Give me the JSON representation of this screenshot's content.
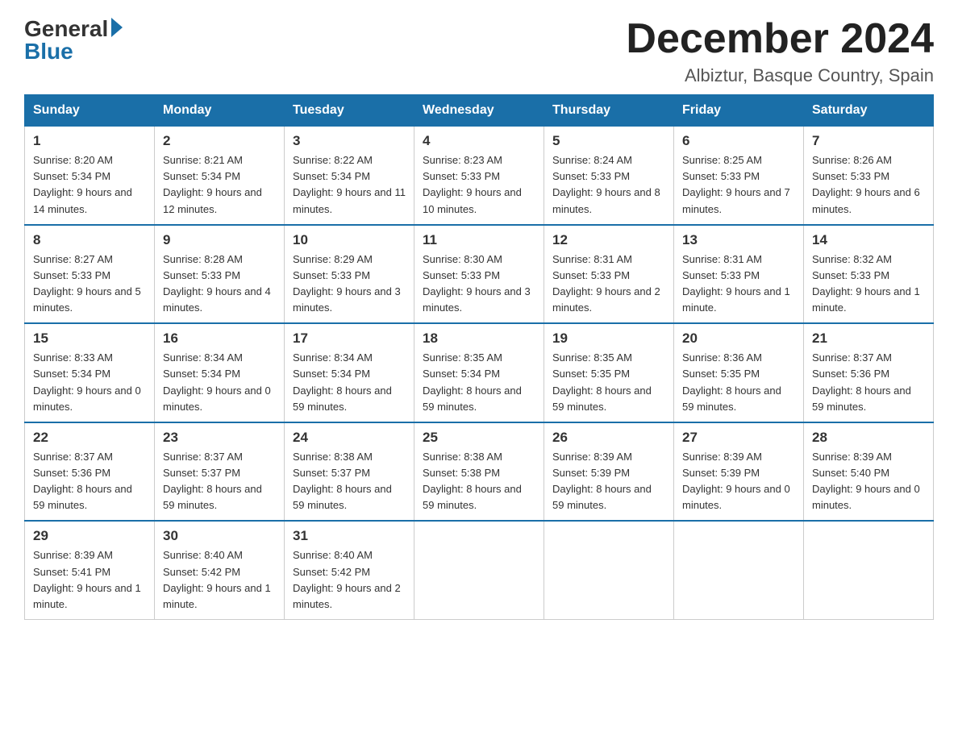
{
  "header": {
    "month_title": "December 2024",
    "location": "Albiztur, Basque Country, Spain",
    "logo_general": "General",
    "logo_blue": "Blue"
  },
  "columns": [
    "Sunday",
    "Monday",
    "Tuesday",
    "Wednesday",
    "Thursday",
    "Friday",
    "Saturday"
  ],
  "weeks": [
    [
      {
        "day": "1",
        "sunrise": "Sunrise: 8:20 AM",
        "sunset": "Sunset: 5:34 PM",
        "daylight": "Daylight: 9 hours and 14 minutes."
      },
      {
        "day": "2",
        "sunrise": "Sunrise: 8:21 AM",
        "sunset": "Sunset: 5:34 PM",
        "daylight": "Daylight: 9 hours and 12 minutes."
      },
      {
        "day": "3",
        "sunrise": "Sunrise: 8:22 AM",
        "sunset": "Sunset: 5:34 PM",
        "daylight": "Daylight: 9 hours and 11 minutes."
      },
      {
        "day": "4",
        "sunrise": "Sunrise: 8:23 AM",
        "sunset": "Sunset: 5:33 PM",
        "daylight": "Daylight: 9 hours and 10 minutes."
      },
      {
        "day": "5",
        "sunrise": "Sunrise: 8:24 AM",
        "sunset": "Sunset: 5:33 PM",
        "daylight": "Daylight: 9 hours and 8 minutes."
      },
      {
        "day": "6",
        "sunrise": "Sunrise: 8:25 AM",
        "sunset": "Sunset: 5:33 PM",
        "daylight": "Daylight: 9 hours and 7 minutes."
      },
      {
        "day": "7",
        "sunrise": "Sunrise: 8:26 AM",
        "sunset": "Sunset: 5:33 PM",
        "daylight": "Daylight: 9 hours and 6 minutes."
      }
    ],
    [
      {
        "day": "8",
        "sunrise": "Sunrise: 8:27 AM",
        "sunset": "Sunset: 5:33 PM",
        "daylight": "Daylight: 9 hours and 5 minutes."
      },
      {
        "day": "9",
        "sunrise": "Sunrise: 8:28 AM",
        "sunset": "Sunset: 5:33 PM",
        "daylight": "Daylight: 9 hours and 4 minutes."
      },
      {
        "day": "10",
        "sunrise": "Sunrise: 8:29 AM",
        "sunset": "Sunset: 5:33 PM",
        "daylight": "Daylight: 9 hours and 3 minutes."
      },
      {
        "day": "11",
        "sunrise": "Sunrise: 8:30 AM",
        "sunset": "Sunset: 5:33 PM",
        "daylight": "Daylight: 9 hours and 3 minutes."
      },
      {
        "day": "12",
        "sunrise": "Sunrise: 8:31 AM",
        "sunset": "Sunset: 5:33 PM",
        "daylight": "Daylight: 9 hours and 2 minutes."
      },
      {
        "day": "13",
        "sunrise": "Sunrise: 8:31 AM",
        "sunset": "Sunset: 5:33 PM",
        "daylight": "Daylight: 9 hours and 1 minute."
      },
      {
        "day": "14",
        "sunrise": "Sunrise: 8:32 AM",
        "sunset": "Sunset: 5:33 PM",
        "daylight": "Daylight: 9 hours and 1 minute."
      }
    ],
    [
      {
        "day": "15",
        "sunrise": "Sunrise: 8:33 AM",
        "sunset": "Sunset: 5:34 PM",
        "daylight": "Daylight: 9 hours and 0 minutes."
      },
      {
        "day": "16",
        "sunrise": "Sunrise: 8:34 AM",
        "sunset": "Sunset: 5:34 PM",
        "daylight": "Daylight: 9 hours and 0 minutes."
      },
      {
        "day": "17",
        "sunrise": "Sunrise: 8:34 AM",
        "sunset": "Sunset: 5:34 PM",
        "daylight": "Daylight: 8 hours and 59 minutes."
      },
      {
        "day": "18",
        "sunrise": "Sunrise: 8:35 AM",
        "sunset": "Sunset: 5:34 PM",
        "daylight": "Daylight: 8 hours and 59 minutes."
      },
      {
        "day": "19",
        "sunrise": "Sunrise: 8:35 AM",
        "sunset": "Sunset: 5:35 PM",
        "daylight": "Daylight: 8 hours and 59 minutes."
      },
      {
        "day": "20",
        "sunrise": "Sunrise: 8:36 AM",
        "sunset": "Sunset: 5:35 PM",
        "daylight": "Daylight: 8 hours and 59 minutes."
      },
      {
        "day": "21",
        "sunrise": "Sunrise: 8:37 AM",
        "sunset": "Sunset: 5:36 PM",
        "daylight": "Daylight: 8 hours and 59 minutes."
      }
    ],
    [
      {
        "day": "22",
        "sunrise": "Sunrise: 8:37 AM",
        "sunset": "Sunset: 5:36 PM",
        "daylight": "Daylight: 8 hours and 59 minutes."
      },
      {
        "day": "23",
        "sunrise": "Sunrise: 8:37 AM",
        "sunset": "Sunset: 5:37 PM",
        "daylight": "Daylight: 8 hours and 59 minutes."
      },
      {
        "day": "24",
        "sunrise": "Sunrise: 8:38 AM",
        "sunset": "Sunset: 5:37 PM",
        "daylight": "Daylight: 8 hours and 59 minutes."
      },
      {
        "day": "25",
        "sunrise": "Sunrise: 8:38 AM",
        "sunset": "Sunset: 5:38 PM",
        "daylight": "Daylight: 8 hours and 59 minutes."
      },
      {
        "day": "26",
        "sunrise": "Sunrise: 8:39 AM",
        "sunset": "Sunset: 5:39 PM",
        "daylight": "Daylight: 8 hours and 59 minutes."
      },
      {
        "day": "27",
        "sunrise": "Sunrise: 8:39 AM",
        "sunset": "Sunset: 5:39 PM",
        "daylight": "Daylight: 9 hours and 0 minutes."
      },
      {
        "day": "28",
        "sunrise": "Sunrise: 8:39 AM",
        "sunset": "Sunset: 5:40 PM",
        "daylight": "Daylight: 9 hours and 0 minutes."
      }
    ],
    [
      {
        "day": "29",
        "sunrise": "Sunrise: 8:39 AM",
        "sunset": "Sunset: 5:41 PM",
        "daylight": "Daylight: 9 hours and 1 minute."
      },
      {
        "day": "30",
        "sunrise": "Sunrise: 8:40 AM",
        "sunset": "Sunset: 5:42 PM",
        "daylight": "Daylight: 9 hours and 1 minute."
      },
      {
        "day": "31",
        "sunrise": "Sunrise: 8:40 AM",
        "sunset": "Sunset: 5:42 PM",
        "daylight": "Daylight: 9 hours and 2 minutes."
      },
      null,
      null,
      null,
      null
    ]
  ]
}
